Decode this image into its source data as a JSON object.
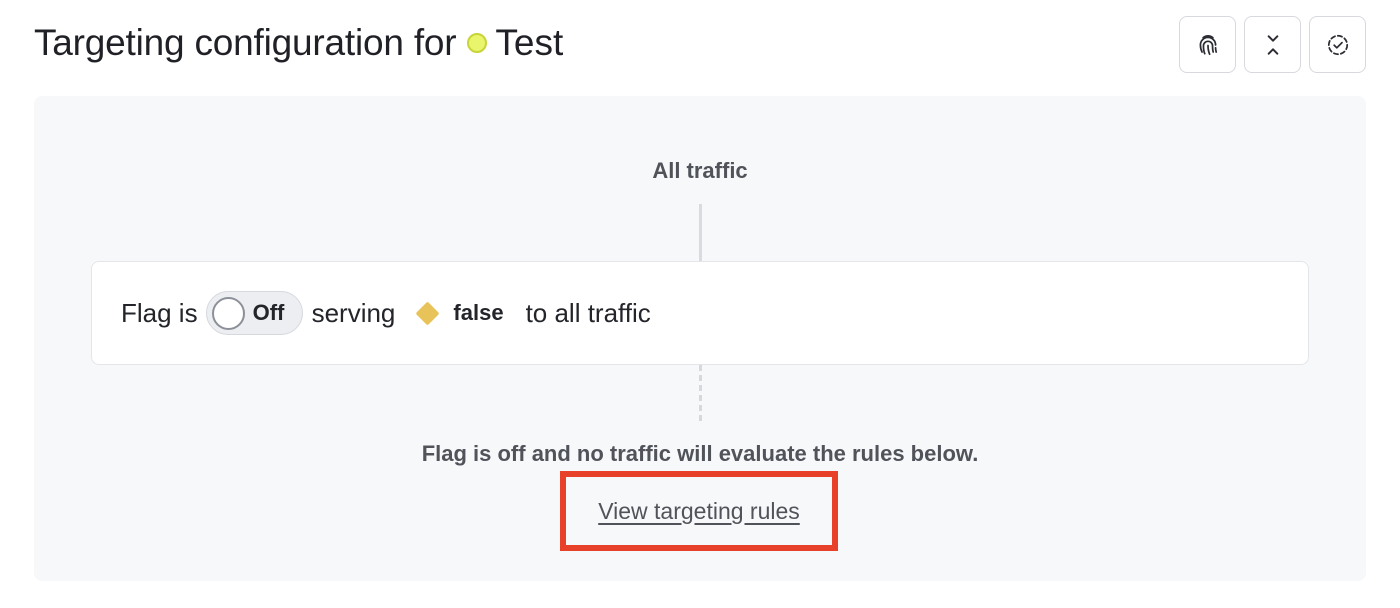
{
  "header": {
    "title": "Targeting configuration for",
    "environment": {
      "name": "Test",
      "color": "#e9f56a"
    }
  },
  "toolbar": {
    "buttons": [
      {
        "icon": "fingerprint-icon"
      },
      {
        "icon": "collapse-icon"
      },
      {
        "icon": "check-circle-dashed-icon"
      }
    ]
  },
  "panel": {
    "all_traffic_label": "All traffic",
    "flag_row": {
      "prefix": "Flag is",
      "toggle_label": "Off",
      "toggle_state": "off",
      "serving_label": "serving",
      "variation_name": "false",
      "variation_color": "#e8c35a",
      "suffix": "to all traffic"
    },
    "off_message": "Flag is off and no traffic will evaluate the rules below.",
    "view_rules_link": "View targeting rules"
  },
  "colors": {
    "highlight_box": "#e8412a",
    "panel_background": "#f7f8fa"
  }
}
